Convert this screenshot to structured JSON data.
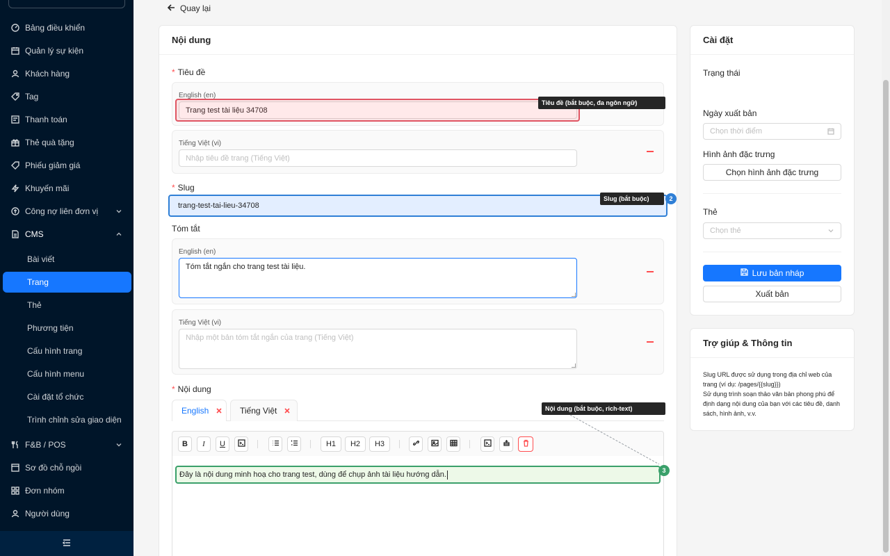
{
  "sidebar": {
    "items": [
      {
        "label": "Bảng điều khiển",
        "icon": "dashboard-icon"
      },
      {
        "label": "Quản lý sự kiện",
        "icon": "calendar-icon"
      },
      {
        "label": "Khách hàng",
        "icon": "user-icon"
      },
      {
        "label": "Tag",
        "icon": "tag-icon"
      },
      {
        "label": "Thanh toán",
        "icon": "payment-icon"
      },
      {
        "label": "Thẻ quà tặng",
        "icon": "gift-icon"
      },
      {
        "label": "Phiếu giảm giá",
        "icon": "coupon-icon"
      },
      {
        "label": "Khuyến mãi",
        "icon": "lightning-icon"
      },
      {
        "label": "Công nợ liên đơn vị",
        "icon": "debt-icon"
      },
      {
        "label": "CMS",
        "icon": "document-icon"
      }
    ],
    "cms_sub": [
      "Bài viết",
      "Trang",
      "Thẻ",
      "Phương tiện",
      "Cấu hình trang",
      "Cấu hình menu",
      "Cài đặt tổ chức",
      "Trình chỉnh sửa giao diện"
    ],
    "bottom_items": [
      {
        "label": "F&B / POS",
        "icon": "fnb-icon"
      },
      {
        "label": "Sơ đồ chỗ ngồi",
        "icon": "seat-icon"
      },
      {
        "label": "Đơn nhóm",
        "icon": "group-icon"
      },
      {
        "label": "Người dùng",
        "icon": "person-icon"
      }
    ]
  },
  "back_label": "Quay lại",
  "content": {
    "title": "Nội dung",
    "title_field_label": "Tiêu đề",
    "title_en_label": "English (en)",
    "title_en_value": "Trang test tài liệu 34708",
    "title_vi_label": "Tiếng Việt (vi)",
    "title_vi_placeholder": "Nhập tiêu đề trang (Tiếng Việt)",
    "slug_label": "Slug",
    "slug_value": "trang-test-tai-lieu-34708",
    "summary_label": "Tóm tắt",
    "summary_en_label": "English (en)",
    "summary_en_value": "Tóm tắt ngắn cho trang test tài liệu.",
    "summary_vi_label": "Tiếng Việt (vi)",
    "summary_vi_placeholder": "Nhập một bản tóm tắt ngắn của trang (Tiếng Việt)",
    "body_label": "Nội dung",
    "tabs": [
      "English",
      "Tiếng Việt"
    ],
    "toolbar": {
      "h1": "H1",
      "h2": "H2",
      "h3": "H3"
    },
    "editor_text": "Đây là nội dung minh hoạ cho trang test, dùng để chụp ảnh tài liệu hướng dẫn."
  },
  "annotations": [
    {
      "text": "Tiêu đề (bắt buộc, đa ngôn ngữ)"
    },
    {
      "text": "Slug (bắt buộc)",
      "badge": "2"
    },
    {
      "text": "Nội dung (bắt buộc, rich-text)",
      "badge": "3"
    }
  ],
  "settings": {
    "title": "Cài đặt",
    "status_label": "Trạng thái",
    "publish_date_label": "Ngày xuất bản",
    "publish_date_placeholder": "Chọn thời điểm",
    "featured_image_label": "Hình ảnh đặc trưng",
    "featured_image_button": "Chọn hình ảnh đặc trưng",
    "tags_label": "Thẻ",
    "tags_placeholder": "Chọn thẻ",
    "save_draft": "Lưu bản nháp",
    "publish": "Xuất bản"
  },
  "help": {
    "title": "Trợ giúp & Thông tin",
    "line1": "Slug URL được sử dụng trong địa chỉ web của trang (ví dụ: /pages/{{slug}})",
    "line2": "Sử dụng trình soạn thảo văn bản phong phú để định dạng nội dung của bạn với các tiêu đề, danh sách, hình ảnh, v.v."
  },
  "colors": {
    "primary": "#1677ff",
    "sidebar_bg": "#001529",
    "danger": "#ff4d4f"
  }
}
